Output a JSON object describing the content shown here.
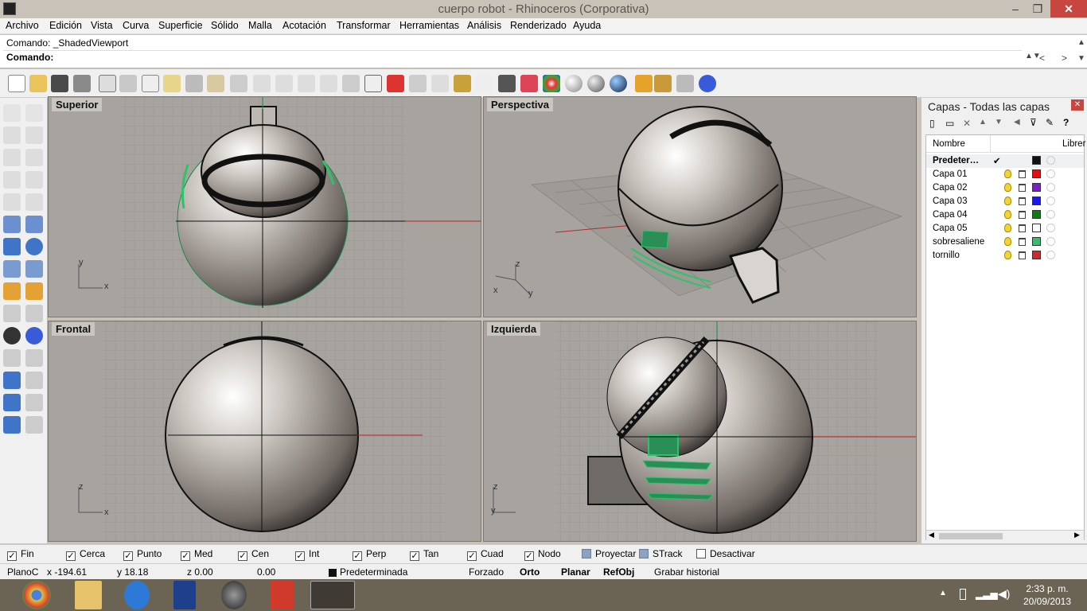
{
  "window": {
    "title": "cuerpo robot - Rhinoceros (Corporativa)",
    "minimize": "–",
    "maximize": "❐",
    "close": "✕"
  },
  "menu": [
    "Archivo",
    "Edición",
    "Vista",
    "Curva",
    "Superficie",
    "Sólido",
    "Malla",
    "Acotación",
    "Transformar",
    "Herramientas",
    "Análisis",
    "Renderizado",
    "Ayuda"
  ],
  "command": {
    "history": "Comando: _ShadedViewport",
    "prompt": "Comando:"
  },
  "viewports": {
    "top": "Superior",
    "perspective": "Perspectiva",
    "front": "Frontal",
    "left": "Izquierda"
  },
  "axes": {
    "top": [
      "y",
      "x"
    ],
    "persp": [
      "z",
      "x",
      "y"
    ],
    "front": [
      "z",
      "x"
    ],
    "left": [
      "z",
      "y"
    ]
  },
  "layers_panel": {
    "title": "Capas - Todas las capas",
    "col_name": "Nombre",
    "col_lib": "Librer",
    "default_check": "✔",
    "layers": [
      {
        "name": "Predeter…",
        "color": "#111111",
        "bold": true
      },
      {
        "name": "Capa 01",
        "color": "#e01010"
      },
      {
        "name": "Capa 02",
        "color": "#7a20c8"
      },
      {
        "name": "Capa 03",
        "color": "#1a1ae6"
      },
      {
        "name": "Capa 04",
        "color": "#127a12"
      },
      {
        "name": "Capa 05",
        "color": "#ffffff"
      },
      {
        "name": "sobresaliene",
        "color": "#3cbb6e"
      },
      {
        "name": "tornillo",
        "color": "#c03030"
      }
    ]
  },
  "osnaps": [
    {
      "label": "Fin",
      "checked": true
    },
    {
      "label": "Cerca",
      "checked": true
    },
    {
      "label": "Punto",
      "checked": true
    },
    {
      "label": "Med",
      "checked": true
    },
    {
      "label": "Cen",
      "checked": true
    },
    {
      "label": "Int",
      "checked": true
    },
    {
      "label": "Perp",
      "checked": true
    },
    {
      "label": "Tan",
      "checked": true
    },
    {
      "label": "Cuad",
      "checked": true
    },
    {
      "label": "Nodo",
      "checked": true
    },
    {
      "label": "Proyectar",
      "checked": false
    },
    {
      "label": "STrack",
      "checked": false
    },
    {
      "label": "Desactivar",
      "checked": false
    }
  ],
  "status": {
    "plane": "PlanoC",
    "x": "x -194.61",
    "y": "y 18.18",
    "z": "z 0.00",
    "d": "0.00",
    "layer": "Predeterminada",
    "forzado": "Forzado",
    "orto": "Orto",
    "planar": "Planar",
    "refobj": "RefObj",
    "grabar": "Grabar historial"
  },
  "clock": {
    "time": "2:33 p. m.",
    "date": "20/09/2013"
  },
  "colors": {
    "accent_green": "#2ec36b",
    "close_red": "#c7463f"
  }
}
